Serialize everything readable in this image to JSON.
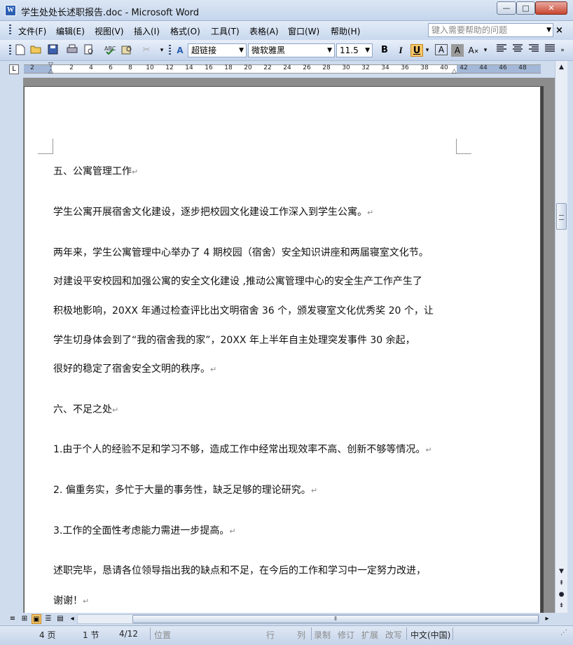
{
  "window": {
    "title": "学生处处长述职报告.doc - Microsoft Word",
    "app_icon": "W",
    "controls": {
      "minimize": "—",
      "maximize": "□",
      "close": "✕"
    }
  },
  "menubar": {
    "items": [
      "文件(F)",
      "编辑(E)",
      "视图(V)",
      "插入(I)",
      "格式(O)",
      "工具(T)",
      "表格(A)",
      "窗口(W)",
      "帮助(H)"
    ],
    "help_placeholder": "键入需要帮助的问题",
    "close_doc": "×"
  },
  "toolbar": {
    "style_value": "超链接",
    "font_value": "微软雅黑",
    "size_value": "11.5",
    "bold": "B",
    "italic": "I",
    "underline": "U",
    "highlight_color": "#f5c66a"
  },
  "ruler": {
    "corner": "L",
    "ticks": [
      "2",
      "2",
      "4",
      "6",
      "8",
      "10",
      "12",
      "14",
      "16",
      "18",
      "20",
      "22",
      "24",
      "26",
      "28",
      "30",
      "32",
      "34",
      "36",
      "38",
      "40",
      "42",
      "44",
      "46",
      "48"
    ]
  },
  "document": {
    "paragraph_mark": "↵",
    "lines": [
      "五、公寓管理工作",
      "学生公寓开展宿舍文化建设，逐步把校园文化建设工作深入到学生公寓。",
      "两年来，学生公寓管理中心举办了 4 期校园（宿舍）安全知识讲座和两届寝室文化节。",
      "对建设平安校园和加强公寓的安全文化建设 ,推动公寓管理中心的安全生产工作产生了",
      "积极地影响，20XX 年通过检查评比出文明宿舍 36 个，颁发寝室文化优秀奖 20 个，让",
      "学生切身体会到了“我的宿舍我的家”，20XX 年上半年自主处理突发事件 30 余起，",
      "很好的稳定了宿舍安全文明的秩序。",
      "六、不足之处",
      "1.由于个人的经验不足和学习不够，造成工作中经常出现效率不高、创新不够等情况。",
      "2. 偏重务实，多忙于大量的事务性，缺乏足够的理论研究。",
      "3.工作的全面性考虑能力需进一步提高。",
      "述职完毕，恳请各位领导指出我的缺点和不足，在今后的工作和学习中一定努力改进，",
      "谢谢！"
    ]
  },
  "statusbar": {
    "page": "4 页",
    "section": "1 节",
    "page_of": "4/12",
    "position": "位置",
    "row": "行",
    "col": "列",
    "rec": "录制",
    "trk": "修订",
    "ext": "扩展",
    "ovr": "改写",
    "language": "中文(中国)"
  }
}
